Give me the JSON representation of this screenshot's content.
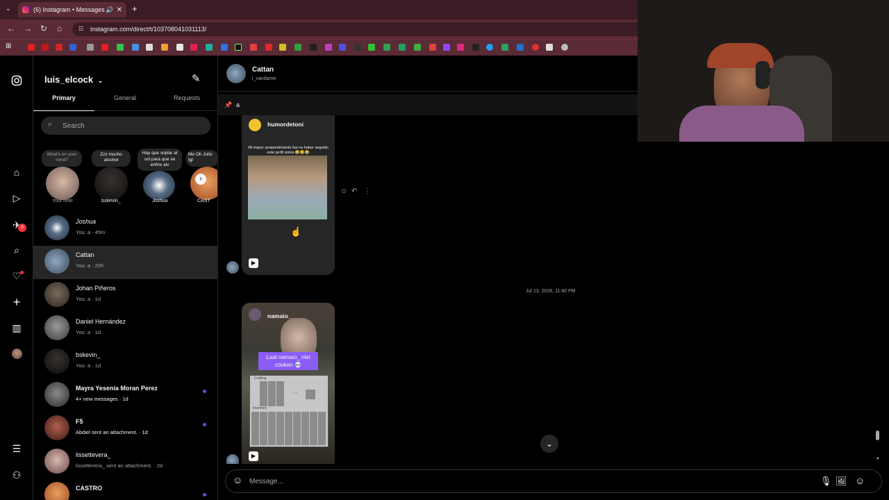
{
  "browser": {
    "tab_title": "(6) Instagram • Messages",
    "url": "instagram.com/direct/t/103708041031113/"
  },
  "rail": {
    "notification_badge": "5"
  },
  "inbox": {
    "username": "luis_elcock",
    "tabs": [
      "Primary",
      "General",
      "Requests"
    ],
    "search_placeholder": "Search",
    "notes": [
      {
        "note": "What's on your mind?",
        "label": "Your note"
      },
      {
        "note": "Zzz mucho alcohol",
        "label": "bskevin_"
      },
      {
        "note": "Hay que soplar al sol para que se enfríe alv",
        "label": "Joshua"
      },
      {
        "note": "Me Oh Julio Igl",
        "label": "CAST"
      }
    ],
    "threads": [
      {
        "name": "Joshua",
        "sub": "You: a · 45m",
        "unread": false
      },
      {
        "name": "Cattan",
        "sub": "You: a · 20h",
        "unread": false
      },
      {
        "name": "Johan Piñeros",
        "sub": "You: a · 1d",
        "unread": false
      },
      {
        "name": "Daniel Hernández",
        "sub": "You: a · 1d",
        "unread": false
      },
      {
        "name": "bskevin_",
        "sub": "You: a · 1d",
        "unread": false
      },
      {
        "name": "Mayra Yesenia Moran Perez",
        "sub": "4+ new messages · 1d",
        "unread": true
      },
      {
        "name": "F5",
        "sub": "Abdiel sent an attachment. · 1d",
        "unread": true
      },
      {
        "name": "lissettevera_",
        "sub": "lissettevera_ sent an attachment. · 2d",
        "unread": false
      },
      {
        "name": "CASTRO",
        "sub": "",
        "unread": true
      }
    ]
  },
  "chat": {
    "name": "Cattan",
    "handle": "i_vandame",
    "pinned": "a",
    "post1": {
      "author": "humordetoni",
      "caption": "Mi mayor arrepentimiento fue no haber seguido este perfil antes 😂😂😂"
    },
    "timestamp": "Jul 13, 2026, 11:40 PM",
    "post2": {
      "author": "namaio_",
      "overlay": "Laat namaio_ niet cooken 💀",
      "crafting": "Crafting",
      "inventory": "Inventory"
    },
    "composer_placeholder": "Message..."
  },
  "colors": {
    "tab_bar": "#3b1c25",
    "toolbar": "#5a2a36",
    "unread_dot": "#4f5bd5",
    "overlay_purple": "#8b5cf6"
  }
}
